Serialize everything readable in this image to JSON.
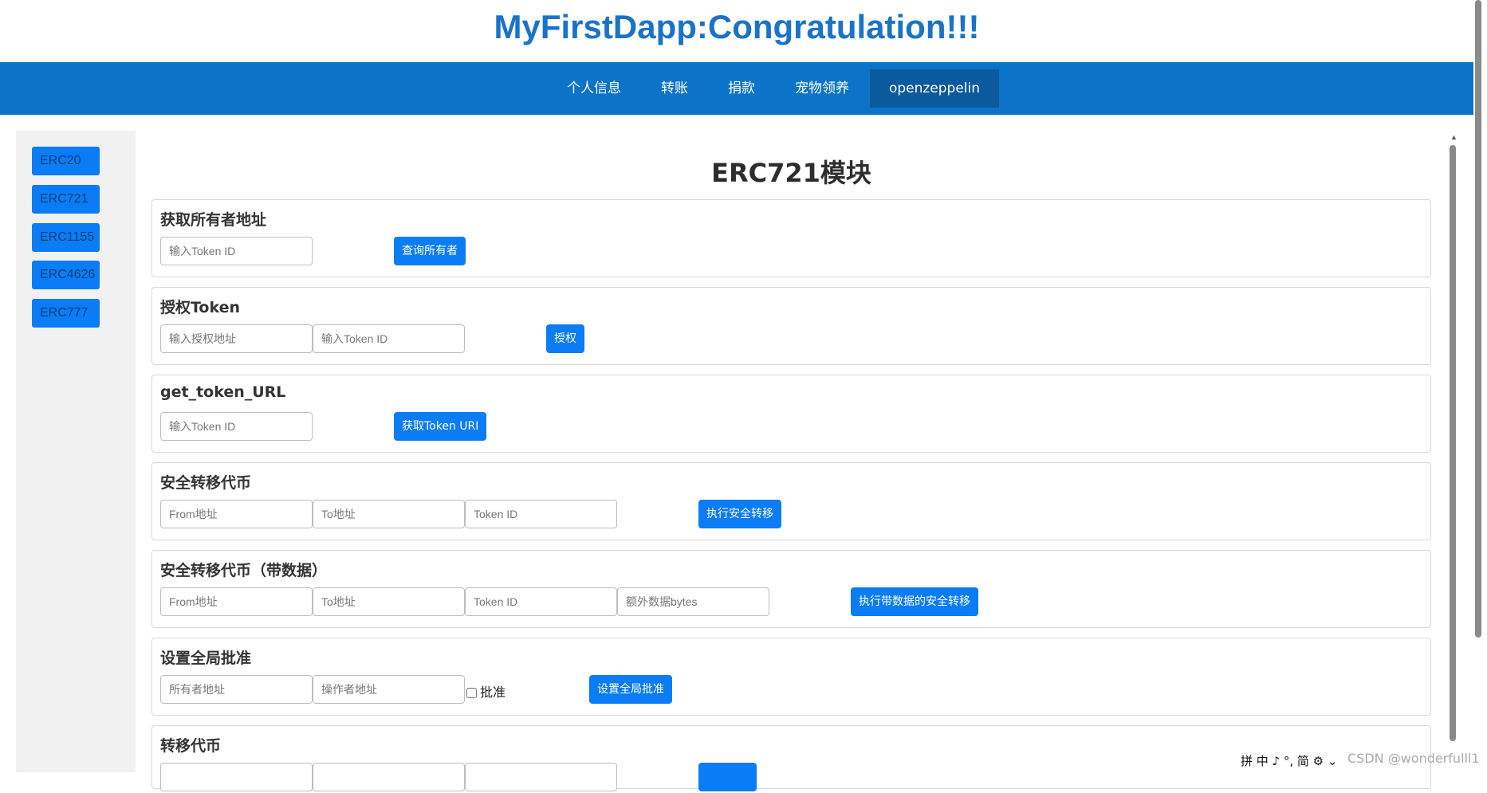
{
  "header": {
    "title": "MyFirstDapp:Congratulation!!!"
  },
  "nav": {
    "items": [
      {
        "label": "个人信息"
      },
      {
        "label": "转账"
      },
      {
        "label": "捐款"
      },
      {
        "label": "宠物领养"
      },
      {
        "label": "openzeppelin",
        "active": true
      }
    ]
  },
  "sidebar": {
    "items": [
      {
        "label": "ERC20"
      },
      {
        "label": "ERC721"
      },
      {
        "label": "ERC1155"
      },
      {
        "label": "ERC4626"
      },
      {
        "label": "ERC777"
      }
    ]
  },
  "main": {
    "title": "ERC721模块",
    "cards": {
      "owner": {
        "title": "获取所有者地址",
        "token_placeholder": "输入Token ID",
        "button": "查询所有者"
      },
      "approve": {
        "title": "授权Token",
        "address_placeholder": "输入授权地址",
        "token_placeholder": "输入Token ID",
        "button": "授权"
      },
      "token_url": {
        "title": "get_token_URL",
        "token_placeholder": "输入Token ID",
        "button": "获取Token URI"
      },
      "safe_transfer": {
        "title": "安全转移代币",
        "from_placeholder": "From地址",
        "to_placeholder": "To地址",
        "token_placeholder": "Token ID",
        "button": "执行安全转移"
      },
      "safe_transfer_data": {
        "title": "安全转移代币（带数据）",
        "from_placeholder": "From地址",
        "to_placeholder": "To地址",
        "token_placeholder": "Token ID",
        "data_placeholder": "额外数据bytes",
        "button": "执行带数据的安全转移"
      },
      "approval_all": {
        "title": "设置全局批准",
        "owner_placeholder": "所有者地址",
        "operator_placeholder": "操作者地址",
        "checkbox_label": "批准",
        "button": "设置全局批准"
      },
      "transfer": {
        "title": "转移代币"
      }
    }
  },
  "ime": {
    "text": "拼 中 ♪ °, 简 ⚙ ⌄"
  },
  "watermark": {
    "text": "CSDN @wonderfulll1"
  },
  "colors": {
    "accent": "#0a7cf5",
    "nav_bg": "#0b74c9",
    "title": "#1a73c8"
  }
}
